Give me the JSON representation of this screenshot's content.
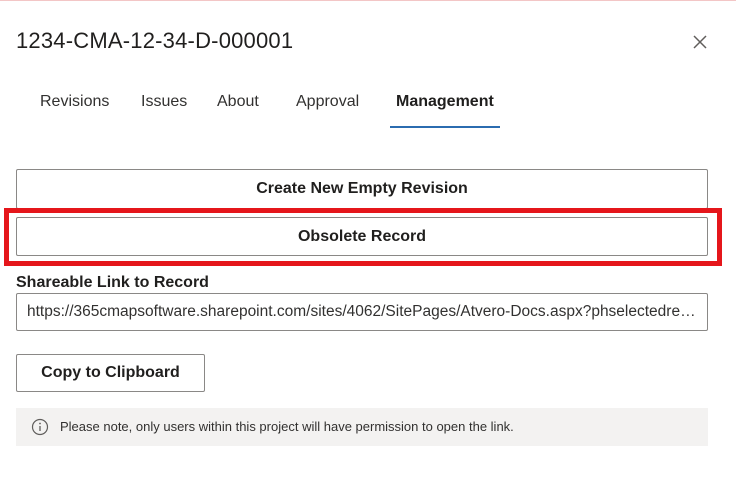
{
  "dialog": {
    "title": "1234-CMA-12-34-D-000001",
    "close_icon": "close-icon"
  },
  "tabs": [
    {
      "label": "Revisions",
      "active": false
    },
    {
      "label": "Issues",
      "active": false
    },
    {
      "label": "About",
      "active": false
    },
    {
      "label": "Approval",
      "active": false
    },
    {
      "label": "Management",
      "active": true
    }
  ],
  "management": {
    "create_revision_label": "Create New Empty Revision",
    "obsolete_record_label": "Obsolete Record",
    "shareable_link_label": "Shareable Link to Record",
    "shareable_link_value": "https://365cmapsoftware.sharepoint.com/sites/4062/SitePages/Atvero-Docs.aspx?phselectedrecord=...",
    "copy_button_label": "Copy to Clipboard",
    "note_text": "Please note, only users within this project will have permission to open the link.",
    "note_icon": "info-icon"
  },
  "colors": {
    "highlight": "#e5161b",
    "tab_underline": "#2b6cb0",
    "note_background": "#f3f2f1"
  }
}
